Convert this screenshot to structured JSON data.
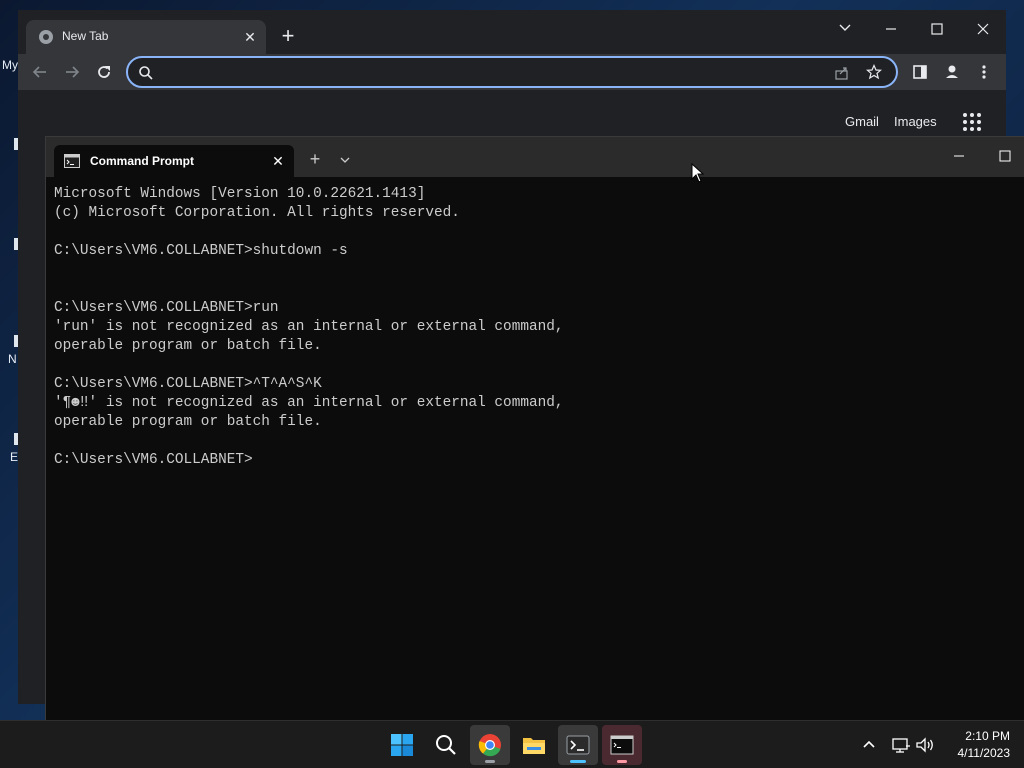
{
  "desktop": {
    "fragments": [
      "My",
      "N",
      "E"
    ]
  },
  "chrome": {
    "tab_title": "New Tab",
    "omnibox_value": "",
    "links": {
      "gmail": "Gmail",
      "images": "Images"
    },
    "accent": "#8ab4f8"
  },
  "terminal": {
    "tab_title": "Command Prompt",
    "lines": [
      "Microsoft Windows [Version 10.0.22621.1413]",
      "(c) Microsoft Corporation. All rights reserved.",
      "",
      "C:\\Users\\VM6.COLLABNET>shutdown -s",
      "",
      "",
      "C:\\Users\\VM6.COLLABNET>run",
      "'run' is not recognized as an internal or external command,",
      "operable program or batch file.",
      "",
      "C:\\Users\\VM6.COLLABNET>^T^A^S^K",
      "'¶☻‼' is not recognized as an internal or external command,",
      "operable program or batch file.",
      "",
      "C:\\Users\\VM6.COLLABNET>"
    ]
  },
  "taskbar": {
    "time": "2:10 PM",
    "date": "4/11/2023",
    "apps": [
      "start-icon",
      "search-icon",
      "chrome-icon",
      "file-explorer-icon",
      "terminal-icon",
      "command-prompt-icon"
    ]
  }
}
